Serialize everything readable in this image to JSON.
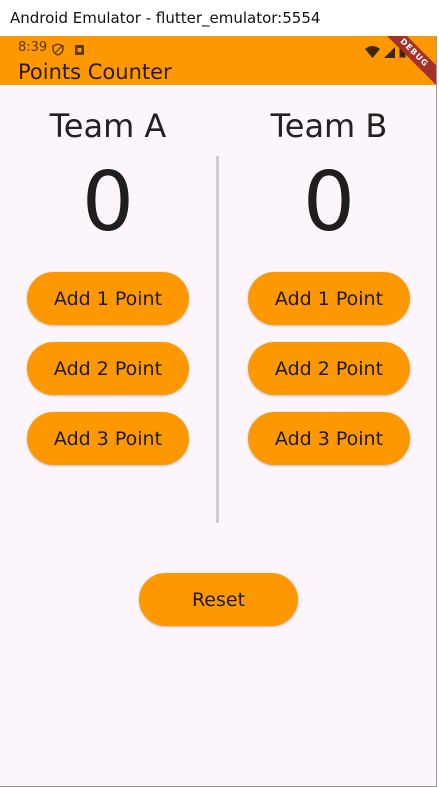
{
  "window": {
    "title": "Android Emulator - flutter_emulator:5554"
  },
  "status_bar": {
    "time": "8:39"
  },
  "app_bar": {
    "title": "Points Counter",
    "debug_banner": "DEBUG"
  },
  "teams": [
    {
      "name": "Team A",
      "score": "0",
      "buttons": [
        "Add 1 Point",
        "Add 2 Point",
        "Add 3 Point"
      ]
    },
    {
      "name": "Team B",
      "score": "0",
      "buttons": [
        "Add 1 Point",
        "Add 2 Point",
        "Add 3 Point"
      ]
    }
  ],
  "reset_label": "Reset",
  "colors": {
    "accent": "#fe9800",
    "background": "#fcf6fc",
    "divider": "#cfcace",
    "debug_ribbon": "#a4302a"
  },
  "icons": [
    "shield-icon",
    "sim-icon",
    "wifi-icon",
    "signal-icon",
    "battery-icon"
  ]
}
